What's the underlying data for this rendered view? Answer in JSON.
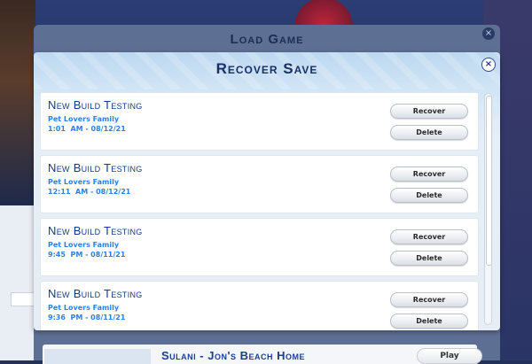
{
  "load_game": {
    "title": "Load Game",
    "close_label": "×",
    "background_row": {
      "title": "Sulani - Jon's Beach Home",
      "play_label": "Play"
    }
  },
  "recover_save": {
    "title": "Recover Save",
    "close_label": "×",
    "saves": [
      {
        "title": "New Build Testing",
        "family": "Pet Lovers Family",
        "time": "1:01  AM - 08/12/21",
        "recover_label": "Recover",
        "delete_label": "Delete"
      },
      {
        "title": "New Build Testing",
        "family": "Pet Lovers Family",
        "time": "12:11  AM - 08/12/21",
        "recover_label": "Recover",
        "delete_label": "Delete"
      },
      {
        "title": "New Build Testing",
        "family": "Pet Lovers Family",
        "time": "9:45  PM - 08/11/21",
        "recover_label": "Recover",
        "delete_label": "Delete"
      },
      {
        "title": "New Build Testing",
        "family": "Pet Lovers Family",
        "time": "9:36  PM - 08/11/21",
        "recover_label": "Recover",
        "delete_label": "Delete"
      }
    ]
  },
  "colors": {
    "title_blue": "#1a2f66",
    "save_title_blue": "#123a86",
    "meta_blue": "#2f7fe0",
    "dialog_bg": "#e7edf4"
  }
}
